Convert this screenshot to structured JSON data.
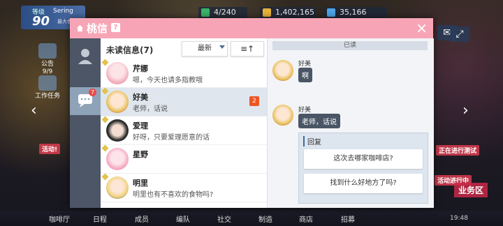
{
  "hud": {
    "level_label": "等级",
    "level": "90",
    "player": "Sering",
    "sub": "最大者",
    "resources": [
      "4/240",
      "1,402,165",
      "35,166"
    ]
  },
  "left_menu": [
    "公告",
    "9/9",
    "工作任务",
    "活动!"
  ],
  "right_panel": {
    "promo1": "正在进行测试",
    "promo2": "活动进行中",
    "area": "业务区"
  },
  "modal": {
    "title": "桃信",
    "help_icon": "?",
    "close_icon": "×",
    "rail_badge": "7",
    "list_header": {
      "label": "未读信息(7)",
      "sort": "最新",
      "order_icon": "≡↑"
    },
    "contacts": [
      {
        "name": "芹娜",
        "msg": "嗯，今天也请多指教哦",
        "unread": ""
      },
      {
        "name": "好美",
        "msg": "老师，话说",
        "unread": "2"
      },
      {
        "name": "爱理",
        "msg": "好呀，只要爱理愿意的话",
        "unread": ""
      },
      {
        "name": "星野",
        "msg": "",
        "unread": ""
      },
      {
        "name": "明里",
        "msg": "明里也有不喜欢的食物吗?",
        "unread": ""
      }
    ],
    "chat": {
      "read_label": "已读",
      "messages": [
        {
          "name": "好美",
          "text": "啊"
        },
        {
          "name": "好美",
          "text": "老师，话说"
        }
      ],
      "reply_label": "回复",
      "options": [
        "这次去哪家咖啡店?",
        "找到什么好地方了吗?"
      ]
    }
  },
  "nav": {
    "items": [
      "咖啡厅",
      "日程",
      "成员",
      "编队",
      "社交",
      "制造",
      "商店",
      "招募"
    ],
    "time": "19:48"
  },
  "colors": {
    "header": "#f7a5b6",
    "rail": "#4d5666",
    "selected": "#dfe6ee",
    "badge": "#ee5522"
  }
}
